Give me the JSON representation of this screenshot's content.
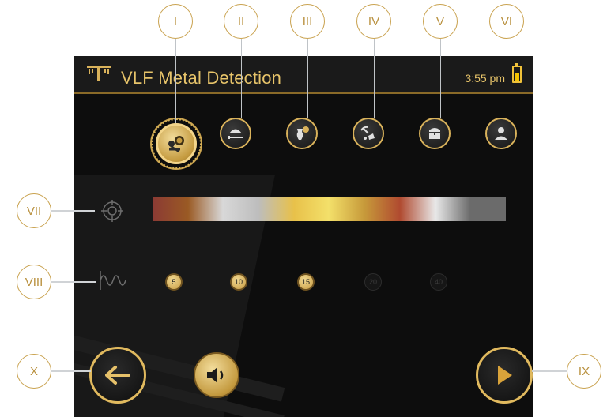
{
  "app": {
    "title": "VLF Metal Detection",
    "time": "3:55 pm",
    "battery_level": 0.55
  },
  "callouts": {
    "I": "I",
    "II": "II",
    "III": "III",
    "IV": "IV",
    "V": "V",
    "VI": "VI",
    "VII": "VII",
    "VIII": "VIII",
    "IX": "IX",
    "X": "X"
  },
  "modes": [
    {
      "icon": "coins-keys-icon",
      "active": true
    },
    {
      "icon": "helmet-sword-icon",
      "active": false
    },
    {
      "icon": "vase-coin-icon",
      "active": false
    },
    {
      "icon": "pickaxe-nugget-icon",
      "active": false
    },
    {
      "icon": "treasure-chest-icon",
      "active": false
    },
    {
      "icon": "person-icon",
      "active": false
    }
  ],
  "target_id_colors": [
    "#8b3a34",
    "#9a5a24",
    "#d8d8d8",
    "#bdbdbd",
    "#e8c14a",
    "#f3e06a",
    "#c79a3a",
    "#b04a30",
    "#e8e8e8",
    "#6b6b6b"
  ],
  "frequencies": [
    {
      "label": "5",
      "enabled": true
    },
    {
      "label": "10",
      "enabled": true
    },
    {
      "label": "15",
      "enabled": true
    },
    {
      "label": "20",
      "enabled": false
    },
    {
      "label": "40",
      "enabled": false
    }
  ],
  "colors": {
    "accent": "#d9b25b",
    "background": "#0d0d0d",
    "callout": "#c9a24f"
  },
  "icons": {
    "logo": "tower-logo-icon",
    "target": "target-crosshair-icon",
    "frequency": "waveform-icon",
    "back": "arrow-left-icon",
    "sound": "speaker-icon",
    "play": "play-icon"
  }
}
